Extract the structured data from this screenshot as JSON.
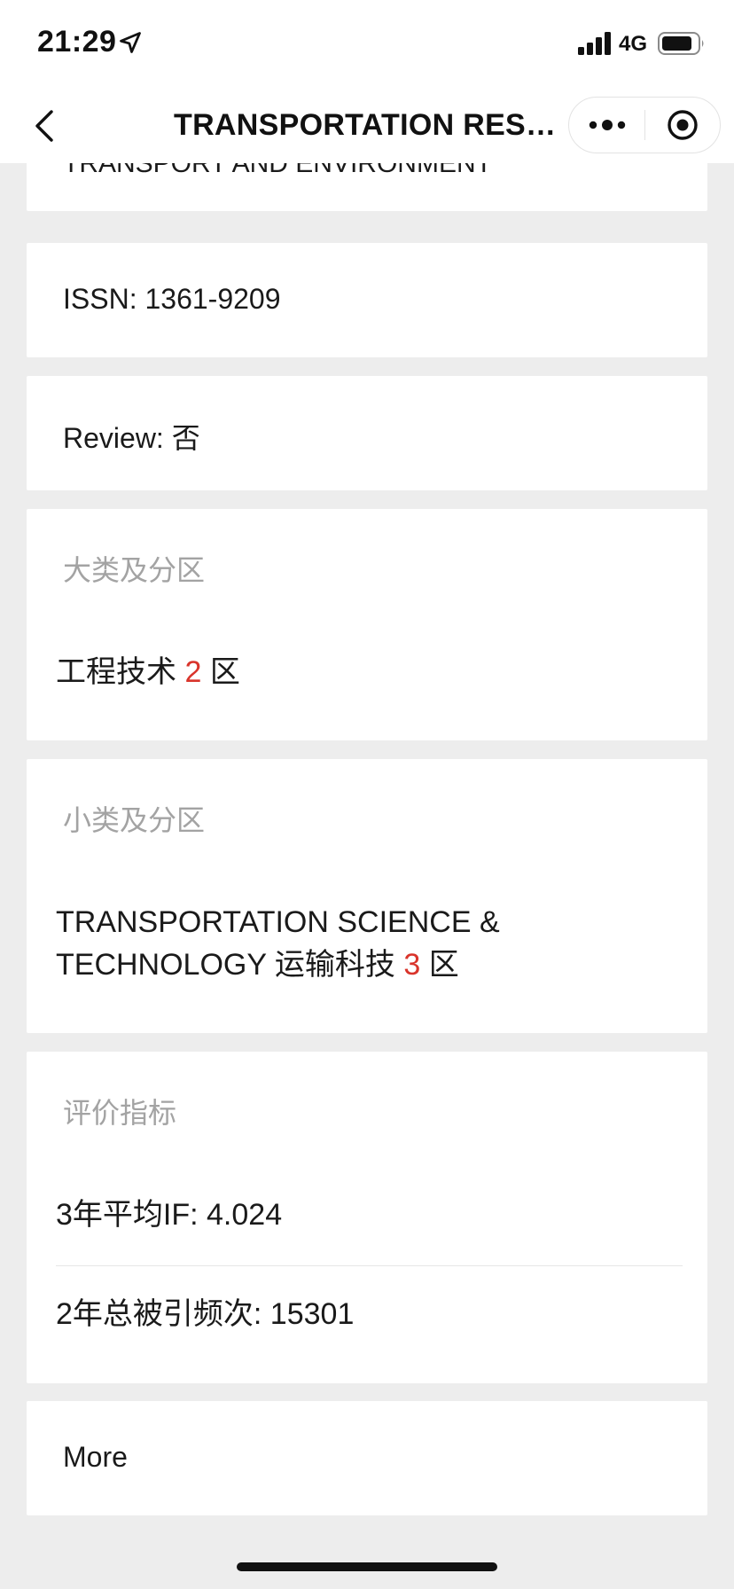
{
  "status_bar": {
    "time": "21:29",
    "network": "4G",
    "icons": [
      "location-arrow-icon",
      "cellular-signal-icon",
      "battery-icon"
    ]
  },
  "nav": {
    "title": "TRANSPORTATION RESE...",
    "back_icon": "chevron-left-icon",
    "more_icon": "more-dots-icon",
    "close_icon": "target-close-icon"
  },
  "cards": {
    "title_tail": "TRANSPORT AND ENVIRONMENT",
    "issn": "ISSN: 1361-9209",
    "review": "Review: 否",
    "major_category": {
      "heading": "大类及分区",
      "name": "工程技术",
      "rank": "2",
      "suffix": "区"
    },
    "minor_category": {
      "heading": "小类及分区",
      "line1": "TRANSPORTATION SCIENCE &",
      "line2_prefix": "TECHNOLOGY 运输科技",
      "rank": "3",
      "suffix": "区"
    },
    "metrics": {
      "heading": "评价指标",
      "if_3yr": "3年平均IF: 4.024",
      "citations_2yr": "2年总被引频次: 15301"
    },
    "more": "More"
  },
  "colors": {
    "background": "#ededed",
    "card": "#ffffff",
    "accent_rank": "#d9342b",
    "heading_gray": "#a3a3a3",
    "text": "#1a1a1a"
  }
}
